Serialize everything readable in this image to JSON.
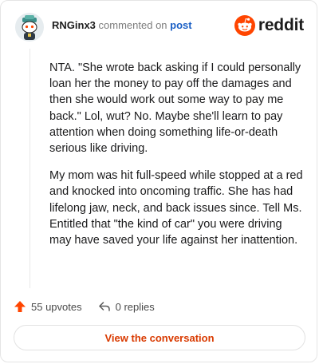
{
  "header": {
    "username": "RNGinx3",
    "action_text": "commented on",
    "post_link": "post",
    "brand": "reddit"
  },
  "comment": {
    "paragraphs": [
      "NTA. \"She wrote back asking if I could personally loan her the money to pay off the damages and then she would work out some way to pay me back.\" Lol, wut? No. Maybe she'll learn to pay attention when doing something life-or-death serious like driving.",
      "My mom was hit full-speed while stopped at a red and knocked into oncoming traffic. She has had lifelong jaw, neck, and back issues since. Tell Ms. Entitled that \"the kind of car\" you were driving may have saved your life against her inattention."
    ]
  },
  "actions": {
    "upvotes": "55 upvotes",
    "replies": "0 replies"
  },
  "cta": {
    "label": "View the conversation"
  },
  "colors": {
    "brand_orange": "#ff4500",
    "link_blue": "#1a5fc5",
    "cta_text": "#d93a00"
  },
  "icons": {
    "avatar": "snoo-avatar",
    "brand": "reddit-snoo-icon",
    "upvote": "arrow-up-icon",
    "reply": "reply-arrow-icon"
  }
}
